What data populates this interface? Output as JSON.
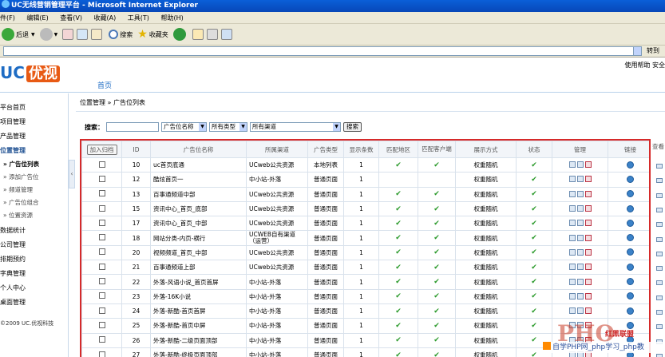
{
  "window": {
    "title": "UC无线营销管理平台 - Microsoft Internet Explorer"
  },
  "menubar": [
    "件(F)",
    "编辑(E)",
    "查看(V)",
    "收藏(A)",
    "工具(T)",
    "帮助(H)"
  ],
  "toolbar": {
    "back": "后退",
    "search": "搜索",
    "favorites": "收藏夹"
  },
  "addressbar": {
    "go": "转到"
  },
  "header": {
    "logo_uc": "UC",
    "logo_you": "优视",
    "links": "使用帮助 安全",
    "home_tab": "首页"
  },
  "sidebar": {
    "items": [
      "平台首页",
      "项目管理",
      "产品管理",
      "位置管理"
    ],
    "subitems": [
      "» 广告位列表",
      "» 添加广告位",
      "» 频道管理",
      "» 广告位组合",
      "» 位置资源"
    ],
    "items2": [
      "数据统计",
      "公司管理",
      "排期预约",
      "字典管理",
      "个人中心",
      "桌面管理"
    ],
    "copyright": "©2009 UC.优视科技"
  },
  "main": {
    "breadcrumb": "位置管理 » 广告位列表",
    "search": {
      "label": "搜索：",
      "select1": "广告位名称",
      "select2": "所有类型",
      "select3": "所有渠道",
      "button": "搜索"
    },
    "table": {
      "add_button": "加入归档",
      "headers": [
        "ID",
        "广告位名称",
        "所属渠道",
        "广告类型",
        "显示条数",
        "匹配地区",
        "匹配客户端",
        "展示方式",
        "状态",
        "管理",
        "链接"
      ],
      "view_header": "查看",
      "rows": [
        {
          "id": "10",
          "name": "uc首页底通",
          "channel": "UCweb公共资源",
          "type": "本地列表",
          "count": "1",
          "region": true,
          "client": true,
          "display": "权重随机",
          "status": true
        },
        {
          "id": "12",
          "name": "酷炫首页一",
          "channel": "中小站-外落",
          "type": "普通页面",
          "count": "1",
          "region": false,
          "client": false,
          "display": "权重随机",
          "status": true
        },
        {
          "id": "13",
          "name": "百事通频道中部",
          "channel": "UCweb公共资源",
          "type": "普通页面",
          "count": "1",
          "region": true,
          "client": true,
          "display": "权重随机",
          "status": true
        },
        {
          "id": "15",
          "name": "资讯中心_首页_底部",
          "channel": "UCweb公共资源",
          "type": "普通页面",
          "count": "1",
          "region": true,
          "client": true,
          "display": "权重随机",
          "status": true
        },
        {
          "id": "17",
          "name": "资讯中心_首页_中部",
          "channel": "UCweb公共资源",
          "type": "普通页面",
          "count": "1",
          "region": true,
          "client": true,
          "display": "权重随机",
          "status": true
        },
        {
          "id": "18",
          "name": "网站分类-内页-横行",
          "channel": "UCWEB自有渠道（运营）",
          "type": "普通页面",
          "count": "1",
          "region": true,
          "client": true,
          "display": "权重随机",
          "status": true
        },
        {
          "id": "20",
          "name": "视频频道_首页_中部",
          "channel": "UCweb公共资源",
          "type": "普通页面",
          "count": "1",
          "region": true,
          "client": true,
          "display": "权重随机",
          "status": true
        },
        {
          "id": "21",
          "name": "百事通频道上部",
          "channel": "UCweb公共资源",
          "type": "普通页面",
          "count": "1",
          "region": true,
          "client": true,
          "display": "权重随机",
          "status": true
        },
        {
          "id": "22",
          "name": "外落-风语小说_首页首屏",
          "channel": "中小站-外落",
          "type": "普通页面",
          "count": "1",
          "region": true,
          "client": true,
          "display": "权重随机",
          "status": true
        },
        {
          "id": "23",
          "name": "外落-16K小说",
          "channel": "中小站-外落",
          "type": "普通页面",
          "count": "1",
          "region": true,
          "client": true,
          "display": "权重随机",
          "status": true
        },
        {
          "id": "24",
          "name": "外落-新酷-首页首屏",
          "channel": "中小站-外落",
          "type": "普通页面",
          "count": "1",
          "region": true,
          "client": true,
          "display": "权重随机",
          "status": true
        },
        {
          "id": "25",
          "name": "外落-新酷-首页中屏",
          "channel": "中小站-外落",
          "type": "普通页面",
          "count": "1",
          "region": true,
          "client": true,
          "display": "权重随机",
          "status": true
        },
        {
          "id": "26",
          "name": "外落-新酷-二级页面顶部",
          "channel": "中小站-外落",
          "type": "普通页面",
          "count": "1",
          "region": true,
          "client": true,
          "display": "权重随机",
          "status": true
        },
        {
          "id": "27",
          "name": "外落-新酷-终极页面顶部",
          "channel": "中小站-外落",
          "type": "普通页面",
          "count": "1",
          "region": true,
          "client": true,
          "display": "权重随机",
          "status": true
        }
      ]
    }
  },
  "watermark": {
    "big": "PHO",
    "brand": "红黑联盟",
    "bar": "自学PHP网_php学习_php教"
  }
}
